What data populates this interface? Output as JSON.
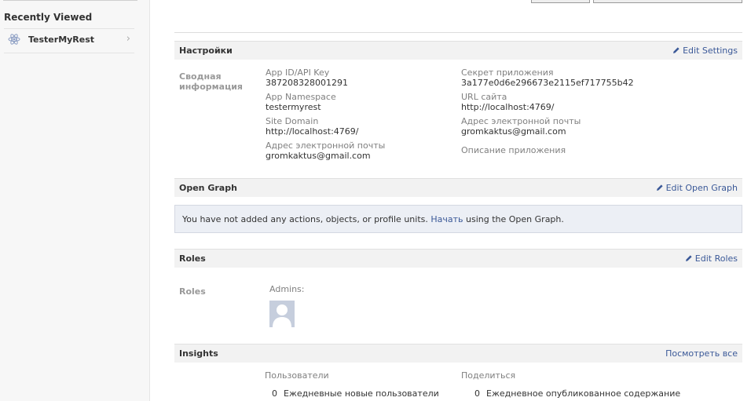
{
  "sidebar": {
    "section_title": "Recently Viewed",
    "items": [
      {
        "label": "TesterMyRest",
        "icon": "react-atom-icon"
      }
    ]
  },
  "settings": {
    "title": "Настройки",
    "edit_label": "Edit Settings",
    "side_label": "Сводная информация",
    "fields_left": [
      {
        "label": "App ID/API Key",
        "value": "387208328001291"
      },
      {
        "label": "App Namespace",
        "value": "testermyrest"
      },
      {
        "label": "Site Domain",
        "value": "http://localhost:4769/"
      },
      {
        "label": "Адрес электронной почты",
        "value": "gromkaktus@gmail.com"
      }
    ],
    "fields_right": [
      {
        "label": "Секрет приложения",
        "value": "3a177e0d6e296673e2115ef717755b42"
      },
      {
        "label": "URL сайта",
        "value": "http://localhost:4769/"
      },
      {
        "label": "Адрес электронной почты",
        "value": "gromkaktus@gmail.com"
      },
      {
        "label": "Описание приложения",
        "value": ""
      }
    ]
  },
  "open_graph": {
    "title": "Open Graph",
    "edit_label": "Edit Open Graph",
    "message_before": "You have not added any actions, objects, or profile units. ",
    "link_text": "Начать",
    "message_after": " using the Open Graph."
  },
  "roles": {
    "title": "Roles",
    "edit_label": "Edit Roles",
    "side_label": "Roles",
    "admins_label": "Admins:"
  },
  "insights": {
    "title": "Insights",
    "view_all_label": "Посмотреть все",
    "columns": [
      {
        "header": "Пользователи",
        "value": "0",
        "label": "Ежедневные новые пользователи"
      },
      {
        "header": "Поделиться",
        "value": "0",
        "label": "Ежедневное опубликованное содержание"
      }
    ]
  },
  "colors": {
    "link": "#3b5998",
    "header_bg": "#f2f2f2",
    "og_box_bg": "#eceff5"
  }
}
